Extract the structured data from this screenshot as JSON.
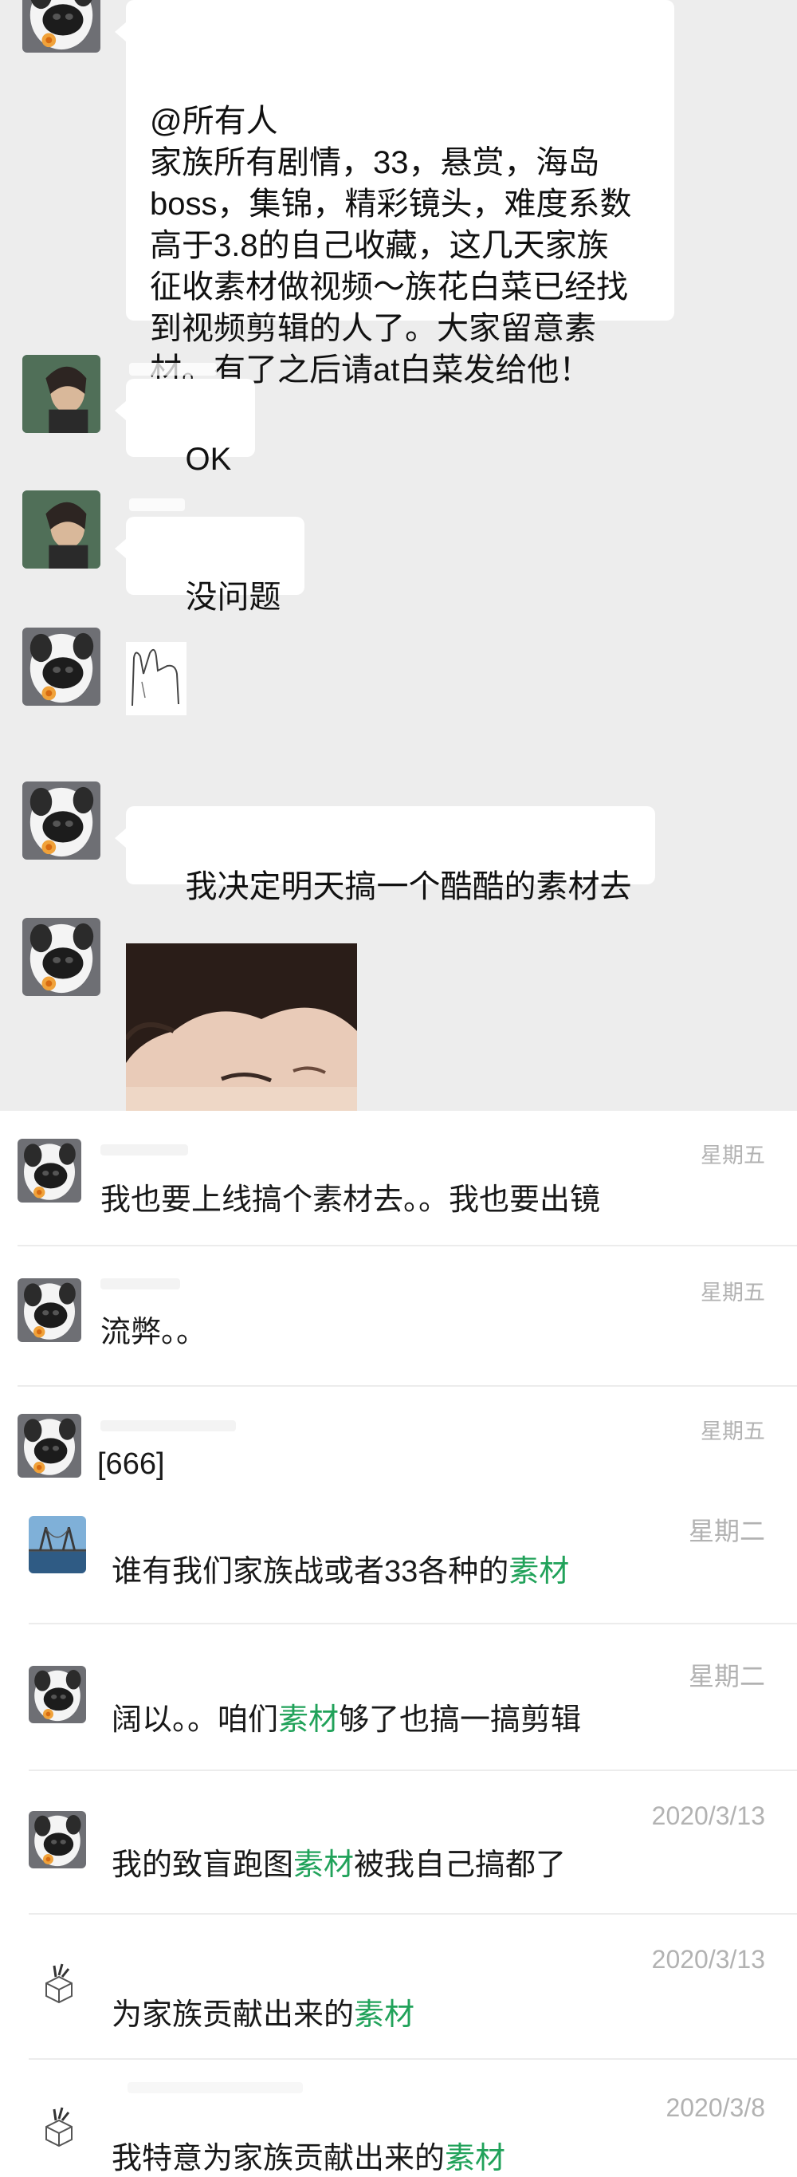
{
  "colors": {
    "chat_background": "#ededed",
    "bubble": "#ffffff",
    "keyword_highlight": "#21a25a",
    "time_gray": "#b2b2b2"
  },
  "chat": {
    "messages": [
      {
        "avatar_icon": "dog-avatar-icon",
        "mention": "@所有人",
        "text": "家族所有剧情，33，悬赏，海岛\nboss，集锦，精彩镜头，难度系数\n高于3.8的自己收藏，这几天家族\n征收素材做视频～族花白菜已经找\n到视频剪辑的人了。大家留意素\n材。有了之后请at白菜发给他！"
      },
      {
        "avatar_icon": "portrait-avatar-icon",
        "text": "OK"
      },
      {
        "avatar_icon": "portrait-avatar-icon",
        "text": "没问题"
      },
      {
        "avatar_icon": "dog-avatar-icon",
        "sticker_icon": "hand-sketch-sticker-icon"
      },
      {
        "avatar_icon": "dog-avatar-icon",
        "text": "我决定明天搞一个酷酷的素材去"
      },
      {
        "avatar_icon": "dog-avatar-icon",
        "photo_icon": "child-photo-icon"
      }
    ]
  },
  "results": [
    {
      "avatar_icon": "dog-avatar-icon",
      "time": "星期五",
      "parts": [
        "我也要上线搞个素材去。。我也要出镜"
      ]
    },
    {
      "avatar_icon": "dog-avatar-icon",
      "time": "星期五",
      "parts": [
        "流弊。。"
      ]
    },
    {
      "avatar_icon": "dog-avatar-icon",
      "time": "星期五",
      "parts": [
        "[666]"
      ]
    },
    {
      "avatar_icon": "bridge-avatar-icon",
      "time": "星期二",
      "parts": [
        "谁有我们家族战或者33各种的",
        "素材",
        ""
      ]
    },
    {
      "avatar_icon": "dog-avatar-icon",
      "time": "星期二",
      "parts": [
        "阔以。。咱们",
        "素材",
        "够了也搞一搞剪辑"
      ]
    },
    {
      "avatar_icon": "dog-avatar-icon",
      "time": "2020/3/13",
      "parts": [
        "我的致盲跑图",
        "素材",
        "被我自己搞都了"
      ]
    },
    {
      "avatar_icon": "box-avatar-icon",
      "time": "2020/3/13",
      "parts": [
        "为家族贡献出来的",
        "素材",
        ""
      ]
    },
    {
      "avatar_icon": "box-avatar-icon",
      "time": "2020/3/8",
      "parts": [
        "我特意为家族贡献出来的",
        "素材",
        ""
      ]
    }
  ]
}
